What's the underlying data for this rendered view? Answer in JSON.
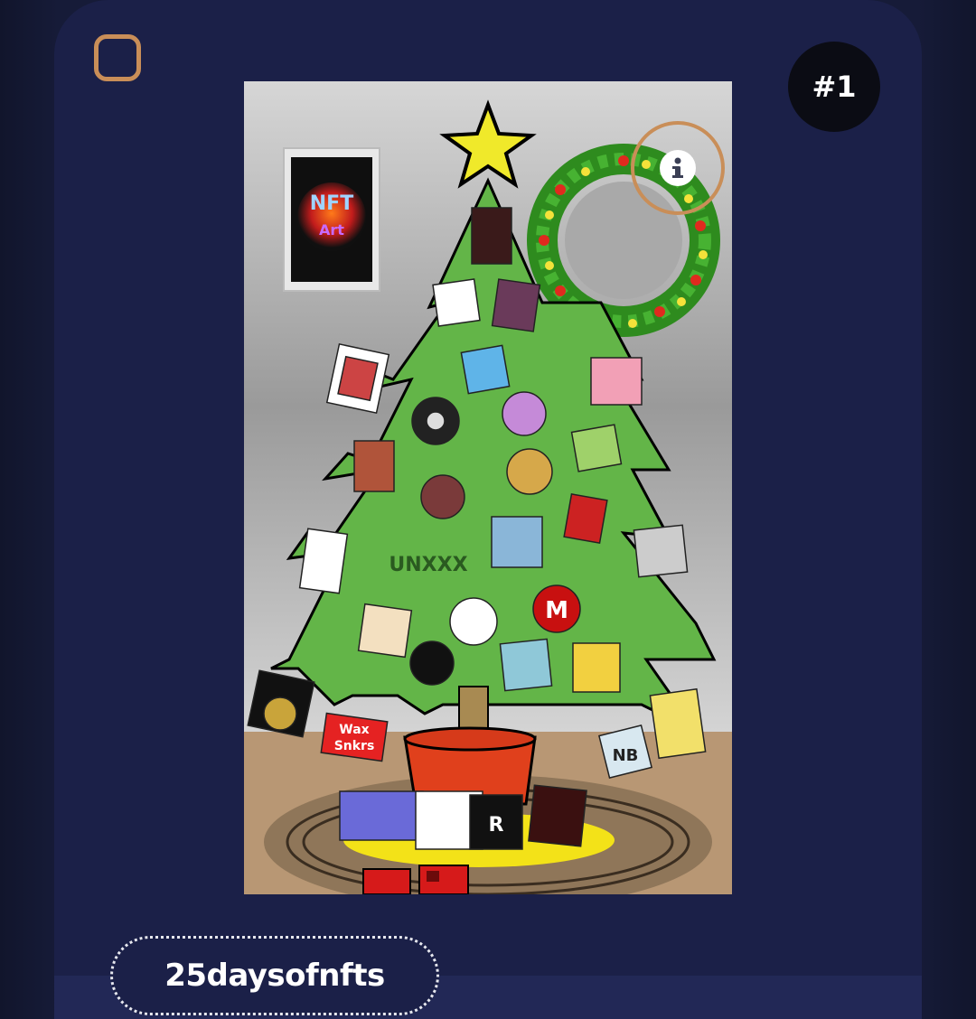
{
  "card": {
    "rank": "#1",
    "collection": "25daysofnfts"
  },
  "icons": {
    "select": "checkbox-icon",
    "info": "info-icon"
  },
  "artwork": {
    "poster_text": [
      "NFT",
      "Art"
    ],
    "ornament_text": [
      "UNXXX",
      "M",
      "NB",
      "Wax",
      "Snkrs",
      "R"
    ]
  },
  "colors": {
    "accent": "#c98e58",
    "card_bg": "#1b2048",
    "badge_bg": "#0b0c14"
  }
}
